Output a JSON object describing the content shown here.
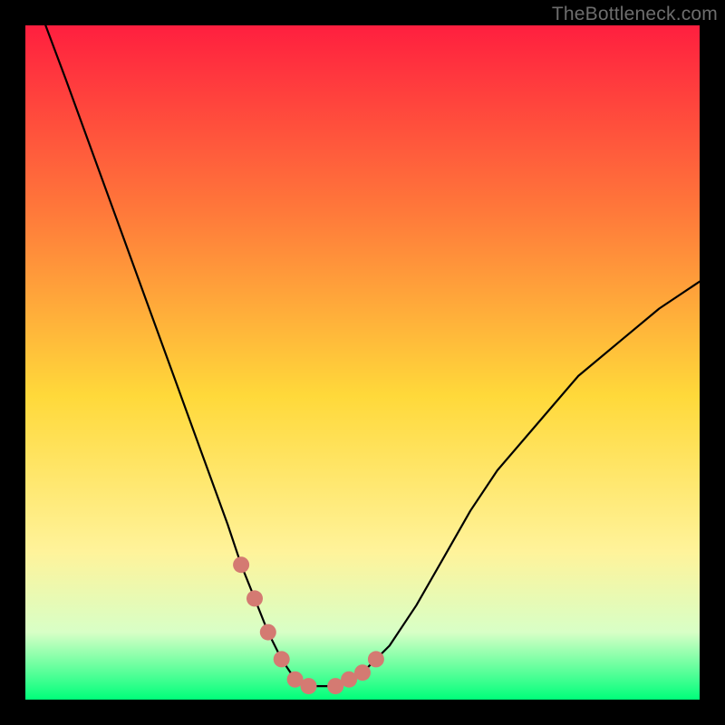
{
  "watermark": "TheBottleneck.com",
  "colors": {
    "gradient_top": "#ff1f3f",
    "gradient_mid_upper": "#ff7a3a",
    "gradient_mid": "#ffd93a",
    "gradient_mid_lower": "#fff39a",
    "gradient_lower": "#d8ffc6",
    "gradient_bottom": "#00ff7a",
    "curve": "#000000",
    "marker": "#d47a72",
    "background": "#000000"
  },
  "chart_data": {
    "type": "line",
    "title": "",
    "xlabel": "",
    "ylabel": "",
    "xlim": [
      0,
      100
    ],
    "ylim": [
      0,
      100
    ],
    "grid": false,
    "legend": false,
    "series": [
      {
        "name": "curve",
        "x": [
          3,
          6,
          10,
          14,
          18,
          22,
          26,
          30,
          32,
          34,
          36,
          38,
          40,
          42,
          46,
          50,
          54,
          58,
          62,
          66,
          70,
          76,
          82,
          88,
          94,
          100
        ],
        "y": [
          100,
          92,
          81,
          70,
          59,
          48,
          37,
          26,
          20,
          15,
          10,
          6,
          3,
          2,
          2,
          4,
          8,
          14,
          21,
          28,
          34,
          41,
          48,
          53,
          58,
          62
        ]
      }
    ],
    "markers": {
      "name": "highlight-dots",
      "x": [
        32,
        34,
        36,
        38,
        40,
        42,
        46,
        48,
        50,
        52
      ],
      "y": [
        20,
        15,
        10,
        6,
        3,
        2,
        2,
        3,
        4,
        6
      ]
    }
  }
}
